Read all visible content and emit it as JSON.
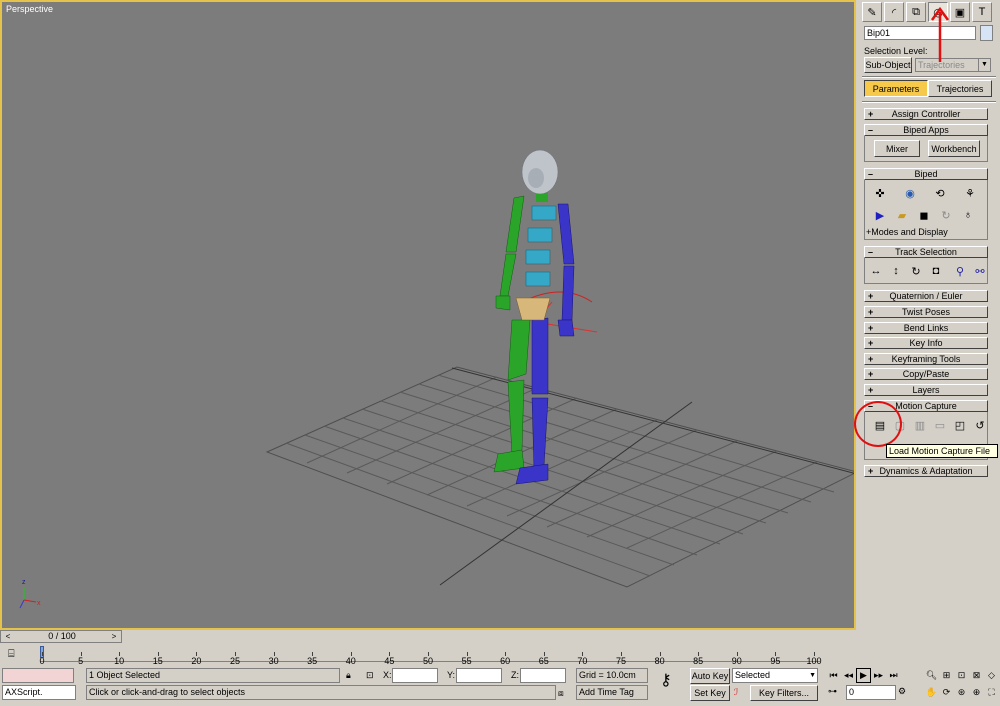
{
  "viewport": {
    "label": "Perspective"
  },
  "command_panel": {
    "tabs": [
      {
        "name": "create-icon",
        "glyph": "✎"
      },
      {
        "name": "modify-icon",
        "glyph": "◜"
      },
      {
        "name": "hierarchy-icon",
        "glyph": "⧉"
      },
      {
        "name": "motion-icon",
        "glyph": "◎"
      },
      {
        "name": "display-icon",
        "glyph": "▣"
      },
      {
        "name": "utilities-icon",
        "glyph": "T"
      }
    ],
    "object_name": "Bip01",
    "selection_level_label": "Selection Level:",
    "sub_object_button": "Sub-Object",
    "sub_object_dropdown": "Trajectories",
    "parameters_tab": "Parameters",
    "trajectories_tab": "Trajectories",
    "rollouts": {
      "assign_controller": "Assign Controller",
      "biped_apps": "Biped Apps",
      "mixer": "Mixer",
      "workbench": "Workbench",
      "biped": "Biped",
      "modes_and_display": "+Modes and Display",
      "track_selection": "Track Selection",
      "quaternion_euler": "Quaternion / Euler",
      "twist_poses": "Twist Poses",
      "bend_links": "Bend Links",
      "key_info": "Key Info",
      "keyframing_tools": "Keyframing Tools",
      "copy_paste": "Copy/Paste",
      "layers": "Layers",
      "motion_capture": "Motion Capture",
      "dynamics_adaptation": "Dynamics & Adaptation"
    },
    "tooltip": "Load Motion Capture File"
  },
  "time_slider": {
    "value": "0 / 100",
    "left": "<",
    "right": ">"
  },
  "track_ticks": [
    "0",
    "5",
    "10",
    "15",
    "20",
    "25",
    "30",
    "35",
    "40",
    "45",
    "50",
    "55",
    "60",
    "65",
    "70",
    "75",
    "80",
    "85",
    "90",
    "95",
    "100"
  ],
  "status": {
    "maxscript": "AXScript.",
    "selection_info": "1 Object Selected",
    "prompt": "Click or click-and-drag to select objects",
    "x_label": "X:",
    "y_label": "Y:",
    "z_label": "Z:",
    "grid": "Grid = 10.0cm",
    "add_time_tag": "Add Time Tag",
    "auto_key": "Auto Key",
    "set_key": "Set Key",
    "selected_dropdown": "Selected",
    "key_filters": "Key Filters...",
    "frame": "0"
  },
  "colors": {
    "viewport_bg": "#7c7c7c",
    "viewport_border": "#e5c24a",
    "active_button": "#f6c94a",
    "annotation": "#e01010"
  }
}
